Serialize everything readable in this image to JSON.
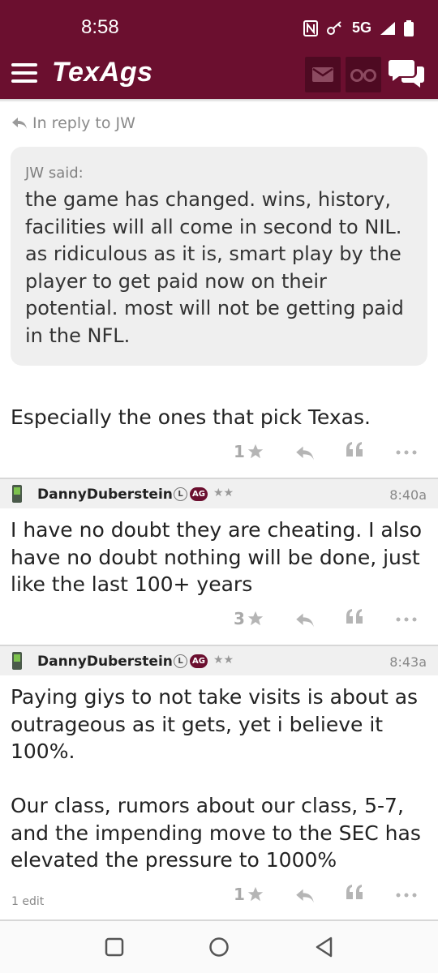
{
  "status_bar": {
    "time": "8:58",
    "network": "5G"
  },
  "app_bar": {
    "logo": "TexAgs"
  },
  "colors": {
    "brand": "#6b0f2f",
    "brand_dark": "#4e0a22",
    "muted": "#a9a9a9"
  },
  "reply": {
    "label": "In reply to JW"
  },
  "quote": {
    "by": "JW said:",
    "text": "the game has changed. wins, history, facilities will all come in second to NIL. as ridiculous as it is, smart play by the player to get paid now on their potential. most will not be getting paid in the NFL."
  },
  "posts": [
    {
      "text": "Especially the ones that pick Texas.",
      "star_count": "1"
    },
    {
      "username": "DannyDuberstein",
      "badge_l": "L",
      "badge_ag": "AG",
      "stars": "★★",
      "time": "8:40a",
      "text": "I have no doubt they are cheating. I also have no doubt nothing will be done, just like the last 100+ years",
      "star_count": "3"
    },
    {
      "username": "DannyDuberstein",
      "badge_l": "L",
      "badge_ag": "AG",
      "stars": "★★",
      "time": "8:43a",
      "text_p1": "Paying giys to not take visits is about as outrageous as it gets, yet i believe it 100%.",
      "text_p2": "Our class, rumors about our class, 5-7, and the impending move to the SEC has elevated the pressure to 1000%",
      "edit_note": "1 edit",
      "star_count": "1"
    }
  ],
  "icons": {
    "menu": "hamburger-icon",
    "mail": "mail-icon",
    "spy": "binoculars-icon",
    "chat": "chat-bubbles-icon",
    "star": "star-icon",
    "reply": "reply-arrow-icon",
    "quote": "quote-icon",
    "more": "more-dots-icon",
    "phone": "mobile-phone-icon"
  }
}
